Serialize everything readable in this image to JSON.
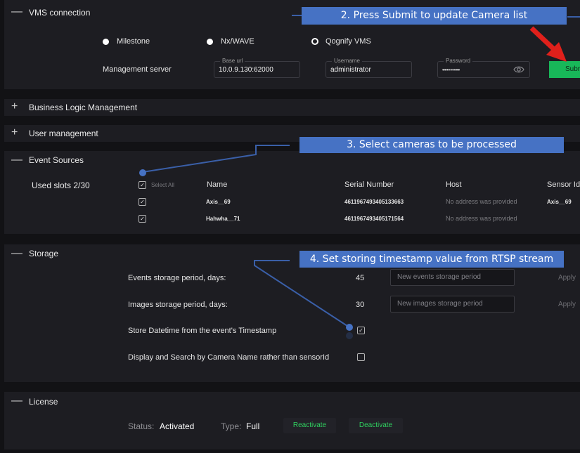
{
  "vms": {
    "title": "VMS connection",
    "radios": [
      {
        "label": "Milestone",
        "selected": true
      },
      {
        "label": "Nx/WAVE",
        "selected": true
      },
      {
        "label": "Qognify VMS",
        "selected": false
      }
    ],
    "management_label": "Management server",
    "base_url_legend": "Base url",
    "base_url_value": "10.0.9.130:62000",
    "username_legend": "Username",
    "username_value": "administrator",
    "password_legend": "Password",
    "password_value": "•••••••••",
    "submit_label": "Subr",
    "submit_color": "#18b759"
  },
  "sections": {
    "business_logic": "Business Logic Management",
    "user_management": "User management",
    "event_sources": "Event Sources",
    "storage": "Storage",
    "license": "License"
  },
  "events": {
    "used_slots": "Used slots 2/30",
    "select_all": "Select All",
    "columns": [
      "Name",
      "Serial Number",
      "Host",
      "Sensor Id"
    ],
    "rows": [
      {
        "name": "Axis__69",
        "serial": "4611967493405133663",
        "host": "No address was provided",
        "sensor": "Axis__69"
      },
      {
        "name": "Hahwha__71",
        "serial": "4611967493405171564",
        "host": "No address was provided",
        "sensor": ""
      }
    ]
  },
  "storage": {
    "events_label": "Events storage period, days:",
    "events_value": "45",
    "events_placeholder": "New events storage period",
    "images_label": "Images storage period, days:",
    "images_value": "30",
    "images_placeholder": "New images storage period",
    "apply_label": "Apply",
    "timestamp_label": "Store Datetime from the event's Timestamp",
    "timestamp_checked": true,
    "camera_name_label": "Display and Search by Camera Name rather than sensorId",
    "camera_name_checked": false
  },
  "license": {
    "status_label": "Status:",
    "status_value": "Activated",
    "type_label": "Type:",
    "type_value": "Full",
    "reactivate_label": "Reactivate",
    "deactivate_label": "Deactivate"
  },
  "callouts": {
    "c2": "2. Press Submit to update Camera list",
    "c3": "3. Select cameras to be processed",
    "c4": "4. Set storing timestamp value from RTSP stream",
    "color": "#4672c4",
    "line_color": "#3a5fa8",
    "arrow_color": "#e0201b"
  }
}
